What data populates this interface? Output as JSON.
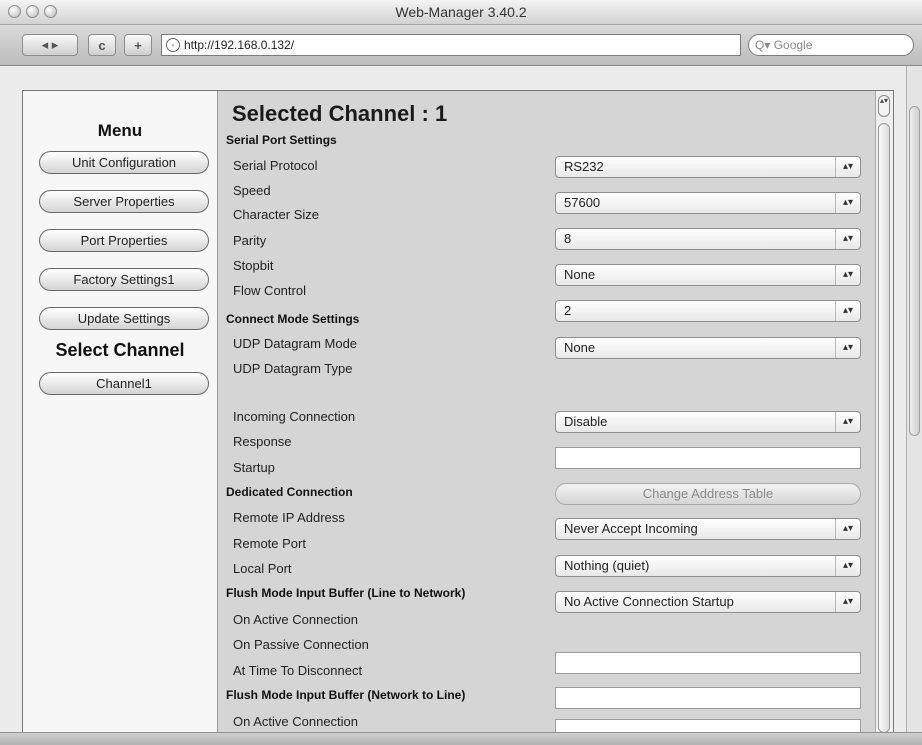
{
  "window": {
    "title": "Web-Manager 3.40.2"
  },
  "toolbar": {
    "back_label": "◂ ▸",
    "reload_label": "c",
    "add_label": "+",
    "url": "http://192.168.0.132/",
    "search_placeholder": "Q▾ Google"
  },
  "menu": {
    "heading": "Menu",
    "items": [
      {
        "label": "Unit Configuration"
      },
      {
        "label": "Server Properties"
      },
      {
        "label": "Port Properties"
      },
      {
        "label": "Factory Settings1"
      },
      {
        "label": "Update Settings"
      }
    ],
    "select_channel_heading": "Select Channel",
    "channel_button": "Channel1"
  },
  "main": {
    "title": "Selected Channel : 1",
    "sections": {
      "serial": "Serial Port Settings",
      "connect": "Connect Mode Settings",
      "dedicated": "Dedicated Connection",
      "flush_ltn": "Flush Mode Input Buffer (Line to Network)",
      "flush_ntl": "Flush Mode Input Buffer (Network to Line)"
    },
    "labels": {
      "serial_protocol": "Serial Protocol",
      "speed": "Speed",
      "character_size": "Character Size",
      "parity": "Parity",
      "stopbit": "Stopbit",
      "flow_control": "Flow Control",
      "udp_mode": "UDP Datagram Mode",
      "udp_type": "UDP Datagram Type",
      "incoming": "Incoming Connection",
      "response": "Response",
      "startup": "Startup",
      "remote_ip": "Remote IP Address",
      "remote_port": "Remote Port",
      "local_port": "Local Port",
      "on_active_1": "On Active Connection",
      "on_passive": "On Passive Connection",
      "at_disconnect": "At Time To Disconnect",
      "on_active_2": "On Active Connection"
    },
    "selects": {
      "s1": "RS232",
      "s2": "57600",
      "s3": "8",
      "s4": "None",
      "s5": "2",
      "s6": "None",
      "s7": "Disable",
      "s8": "Never Accept Incoming",
      "s9": "Nothing (quiet)",
      "s10": "No Active Connection Startup"
    },
    "change_address_button": "Change Address Table"
  },
  "icons": {
    "select_arrow": "⬍",
    "globe": "globe-icon",
    "arrow_glyph": "▴▾"
  }
}
